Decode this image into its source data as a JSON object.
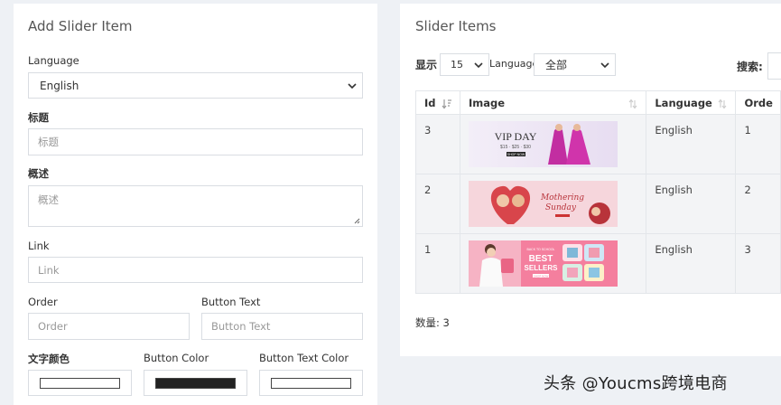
{
  "add_form": {
    "title": "Add Slider Item",
    "language_label": "Language",
    "language_value": "English",
    "title_label": "标题",
    "title_placeholder": "标题",
    "desc_label": "概述",
    "desc_placeholder": "概述",
    "link_label": "Link",
    "link_placeholder": "Link",
    "order_label": "Order",
    "order_placeholder": "Order",
    "button_text_label": "Button Text",
    "button_text_placeholder": "Button Text",
    "text_color_label": "文字颜色",
    "button_color_label": "Button Color",
    "button_text_color_label": "Button Text Color",
    "text_color": "#ffffff",
    "button_color": "#222222",
    "button_text_color": "#ffffff"
  },
  "list": {
    "title": "Slider Items",
    "show_label": "显示",
    "page_size": "15",
    "language_label": "Language",
    "language_filter": "全部",
    "search_label": "搜索:",
    "columns": [
      "Id",
      "Image",
      "Language",
      "Orde"
    ],
    "rows": [
      {
        "id": "3",
        "image": "vip-day-banner",
        "language": "English",
        "order": "1"
      },
      {
        "id": "2",
        "image": "mothering-sunday-banner",
        "language": "English",
        "order": "2"
      },
      {
        "id": "1",
        "image": "best-sellers-banner",
        "language": "English",
        "order": "3"
      }
    ],
    "count_text": "数量: 3"
  },
  "banners": {
    "vip_title": "VIP DAY",
    "vip_offers": "$15 · $25 · $30",
    "vip_button": "SHOP NOW",
    "mothering_line1": "Mothering",
    "mothering_line2": "Sunday",
    "best_small": "BACK TO SCHOOL",
    "best_line1": "BEST",
    "best_line2": "SELLERS",
    "best_button": "SHOP NOW"
  },
  "watermark": "头条 @Youcms跨境电商"
}
